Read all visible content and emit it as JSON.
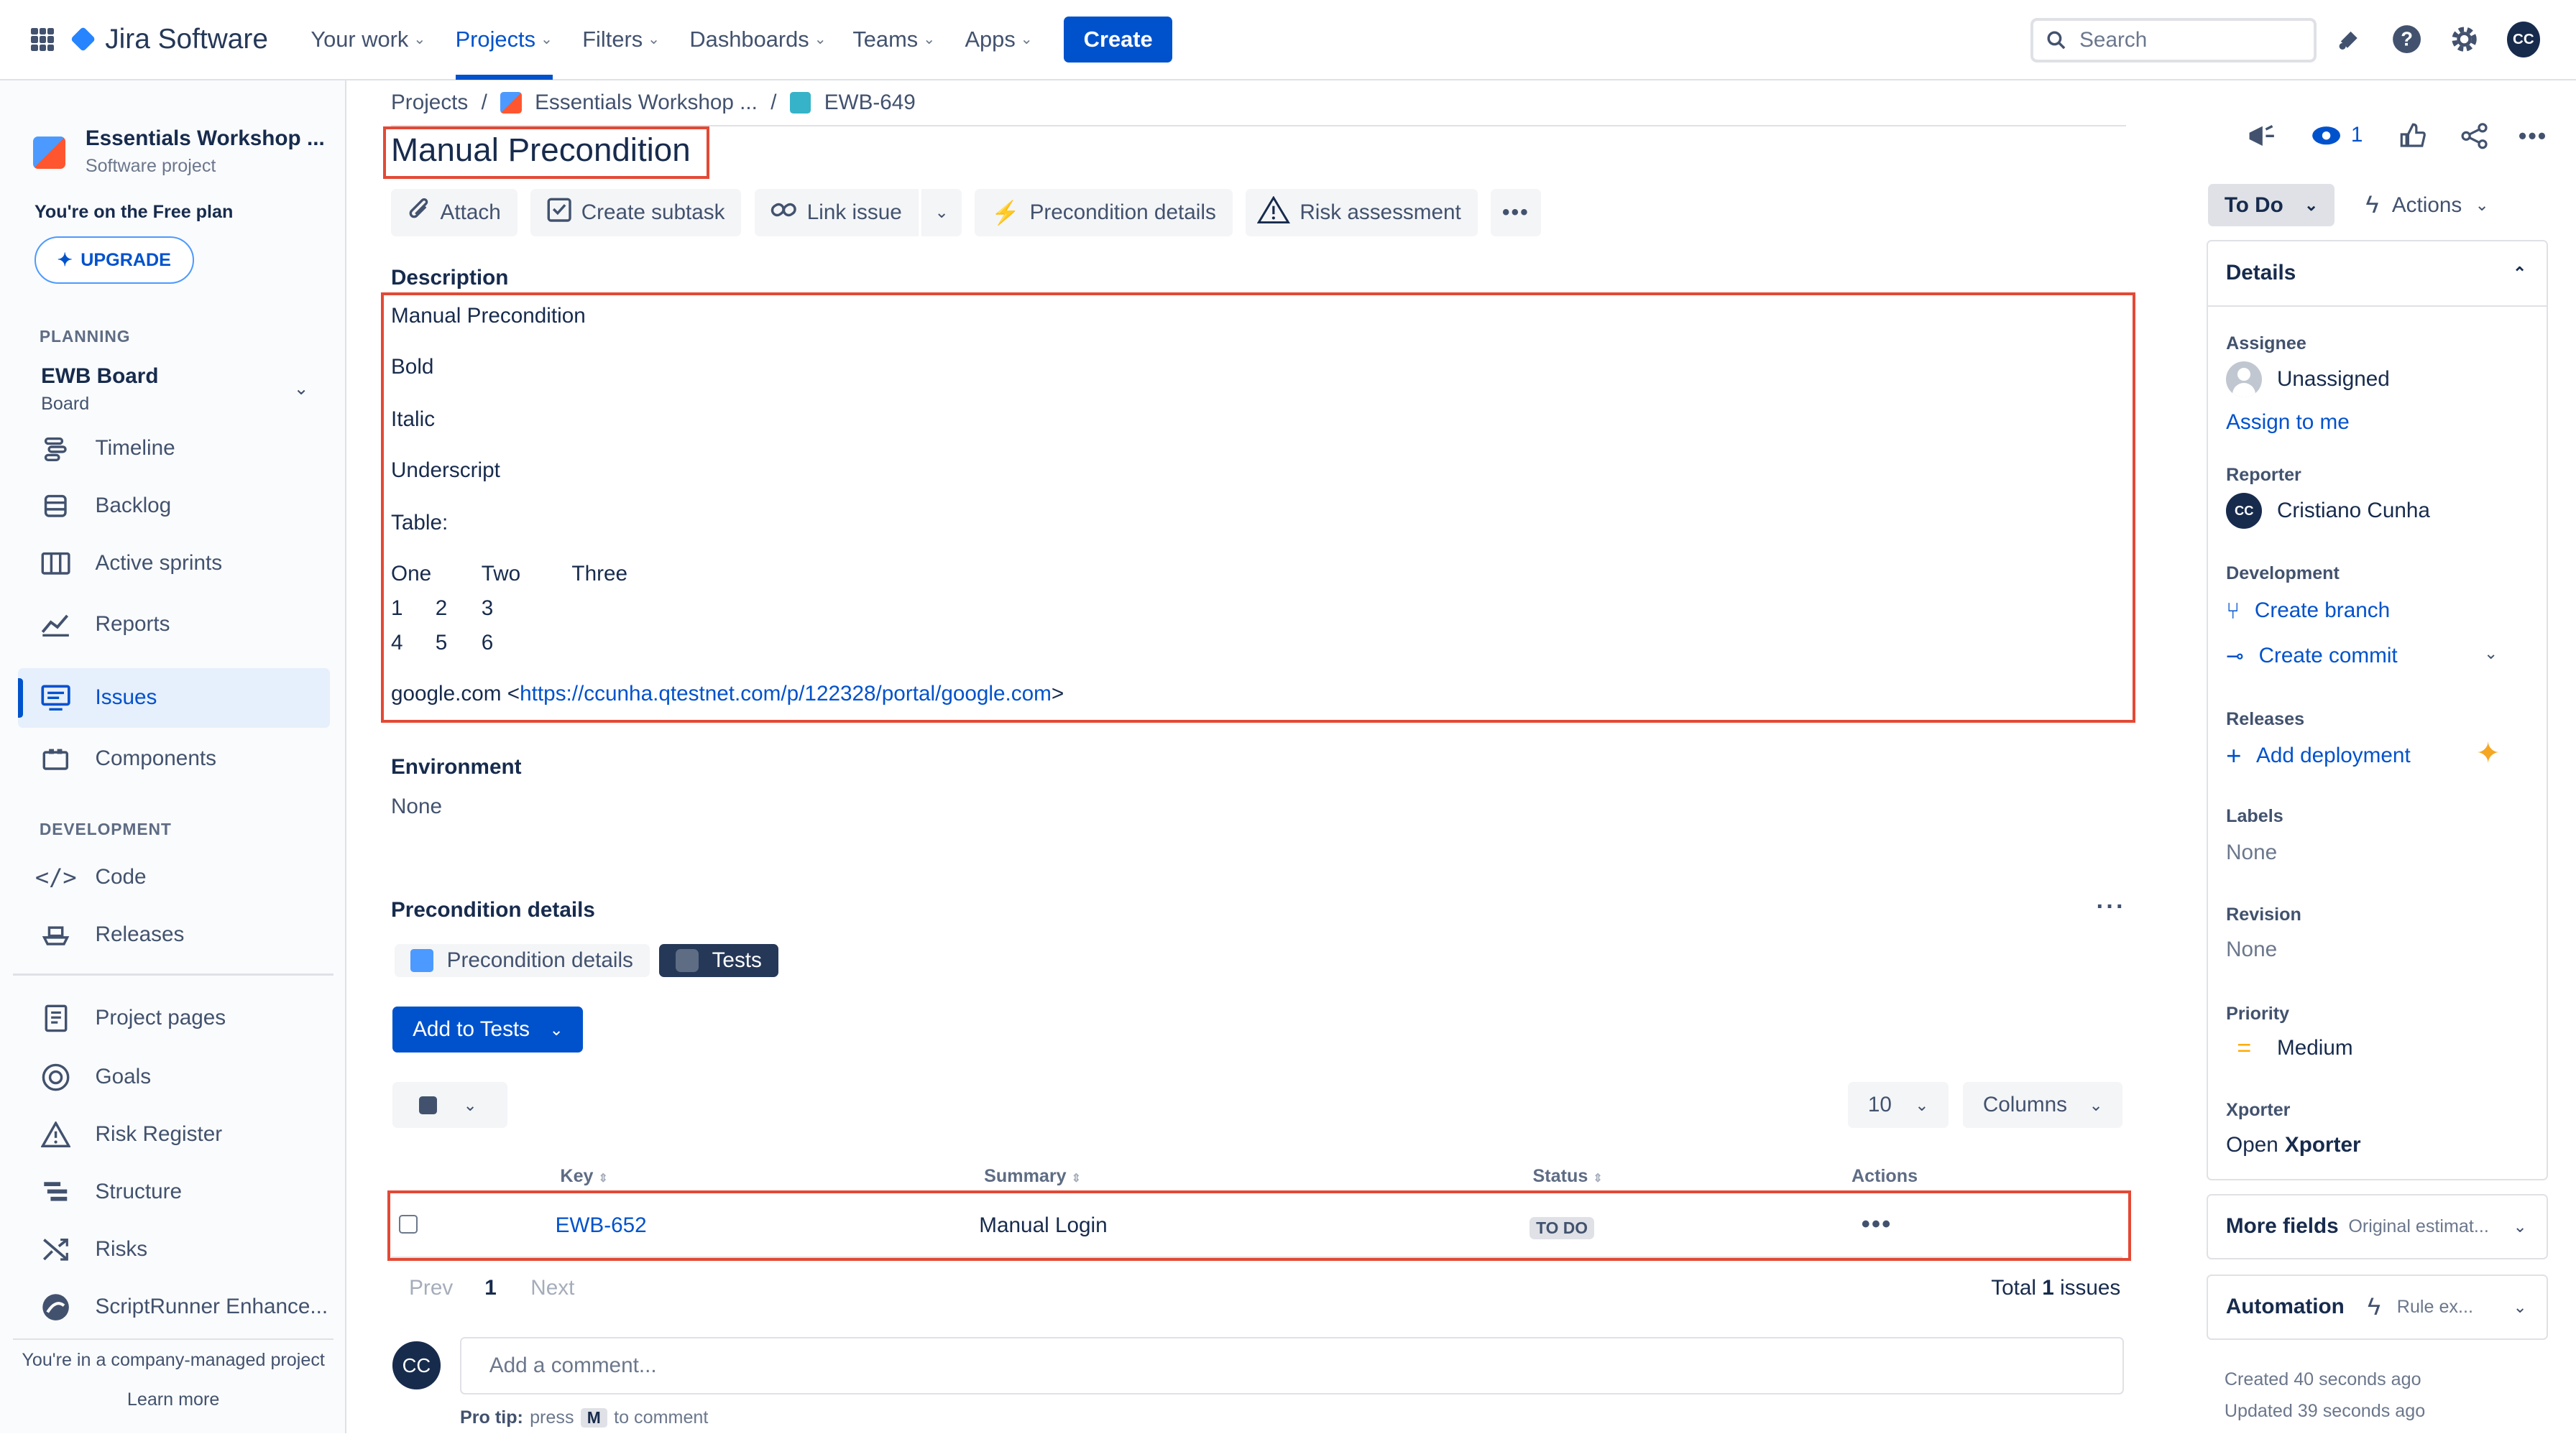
{
  "app": {
    "name": "Jira Software"
  },
  "nav": {
    "items": [
      {
        "label": "Your work"
      },
      {
        "label": "Projects"
      },
      {
        "label": "Filters"
      },
      {
        "label": "Dashboards"
      },
      {
        "label": "Teams"
      },
      {
        "label": "Apps"
      }
    ],
    "create_label": "Create",
    "search_placeholder": "Search",
    "user_initials": "CC"
  },
  "sidebar": {
    "project_name": "Essentials Workshop ...",
    "project_type": "Software project",
    "plan_text": "You're on the Free plan",
    "upgrade_label": "UPGRADE",
    "planning_heading": "PLANNING",
    "board_name": "EWB Board",
    "board_sub": "Board",
    "planning_items": [
      {
        "label": "Timeline",
        "icon": "timeline-icon"
      },
      {
        "label": "Backlog",
        "icon": "backlog-icon"
      },
      {
        "label": "Active sprints",
        "icon": "board-icon"
      },
      {
        "label": "Reports",
        "icon": "reports-icon"
      },
      {
        "label": "Issues",
        "icon": "issues-icon"
      },
      {
        "label": "Components",
        "icon": "components-icon"
      }
    ],
    "development_heading": "DEVELOPMENT",
    "development_items": [
      {
        "label": "Code",
        "icon": "code-icon"
      },
      {
        "label": "Releases",
        "icon": "ship-icon"
      }
    ],
    "other_items": [
      {
        "label": "Project pages",
        "icon": "page-icon"
      },
      {
        "label": "Goals",
        "icon": "target-icon"
      },
      {
        "label": "Risk Register",
        "icon": "warning-icon"
      },
      {
        "label": "Structure",
        "icon": "structure-icon"
      },
      {
        "label": "Risks",
        "icon": "risks-icon"
      },
      {
        "label": "ScriptRunner Enhance...",
        "icon": "scriptrunner-icon"
      }
    ],
    "footer_text": "You're in a company-managed project",
    "learn_more": "Learn more"
  },
  "breadcrumb": {
    "projects": "Projects",
    "project": "Essentials Workshop ...",
    "issue_key": "EWB-649",
    "separator": "/"
  },
  "issue": {
    "title": "Manual Precondition",
    "toolbar": {
      "attach": "Attach",
      "create_subtask": "Create subtask",
      "link_issue": "Link issue",
      "precondition_details": "Precondition details",
      "risk_assessment": "Risk assessment"
    },
    "description_label": "Description",
    "description": {
      "line1": "Manual Precondition",
      "bold": "Bold",
      "italic": "Italic",
      "underscript": "Underscript",
      "table_label": "Table:",
      "table": [
        [
          "One",
          "Two",
          "Three"
        ],
        [
          "1",
          "2",
          "3"
        ],
        [
          "4",
          "5",
          "6"
        ]
      ],
      "link_prefix": "google.com <",
      "link_url": "https://ccunha.qtestnet.com/p/122328/portal/google.com",
      "link_suffix": ">"
    },
    "environment_label": "Environment",
    "environment_value": "None",
    "precondition_details_label": "Precondition details",
    "tabs": [
      {
        "label": "Precondition details"
      },
      {
        "label": "Tests"
      }
    ],
    "add_to_tests_label": "Add to Tests",
    "page_size": "10",
    "columns_label": "Columns",
    "table_headers": {
      "key": "Key",
      "summary": "Summary",
      "status": "Status",
      "actions": "Actions"
    },
    "rows": [
      {
        "key": "EWB-652",
        "summary": "Manual Login",
        "status": "TO DO"
      }
    ],
    "pager": {
      "prev": "Prev",
      "page": "1",
      "next": "Next",
      "total_prefix": "Total",
      "total_count": "1",
      "total_suffix": "issues"
    },
    "comment": {
      "avatar": "CC",
      "placeholder": "Add a comment...",
      "pro_tip_label": "Pro tip:",
      "pro_tip_press": "press",
      "pro_tip_key": "M",
      "pro_tip_suffix": "to comment"
    }
  },
  "right_panel": {
    "watch_count": "1",
    "status_label": "To Do",
    "actions_label": "Actions",
    "details_heading": "Details",
    "assignee_label": "Assignee",
    "assignee_value": "Unassigned",
    "assign_to_me": "Assign to me",
    "reporter_label": "Reporter",
    "reporter_initials": "CC",
    "reporter_value": "Cristiano Cunha",
    "development_label": "Development",
    "create_branch": "Create branch",
    "create_commit": "Create commit",
    "releases_label": "Releases",
    "add_deployment": "Add deployment",
    "labels_label": "Labels",
    "labels_value": "None",
    "revision_label": "Revision",
    "revision_value": "None",
    "priority_label": "Priority",
    "priority_value": "Medium",
    "xporter_label": "Xporter",
    "xporter_prefix": "Open",
    "xporter_name": "Xporter",
    "more_fields": "More fields",
    "more_fields_sub": "Original estimat...",
    "automation": "Automation",
    "automation_sub": "Rule ex...",
    "created": "Created 40 seconds ago",
    "updated": "Updated 39 seconds ago"
  },
  "colors": {
    "accent": "#0052cc",
    "highlight_box": "#e34935",
    "text": "#172b4d"
  }
}
